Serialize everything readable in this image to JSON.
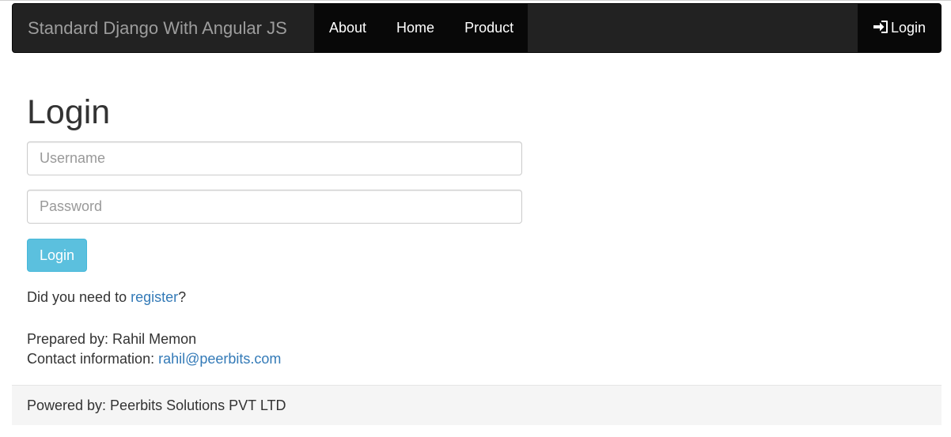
{
  "navbar": {
    "brand": "Standard Django With Angular JS",
    "links": [
      "About",
      "Home",
      "Product"
    ],
    "login_label": "Login",
    "login_icon": "log-in-icon"
  },
  "login_form": {
    "title": "Login",
    "username_placeholder": "Username",
    "password_placeholder": "Password",
    "submit_label": "Login",
    "register_prefix": "Did you need to ",
    "register_link": "register",
    "register_suffix": "?"
  },
  "credits": {
    "prepared_by": "Prepared by: Rahil Memon",
    "contact_prefix": "Contact information: ",
    "contact_email": "rahil@peerbits.com"
  },
  "footer": {
    "text": "Powered by: Peerbits Solutions PVT LTD"
  },
  "colors": {
    "navbar_bg": "#222222",
    "navbar_active_bg": "#080808",
    "button_info": "#5bc0de",
    "link": "#337ab7",
    "footer_bg": "#f5f5f5"
  }
}
